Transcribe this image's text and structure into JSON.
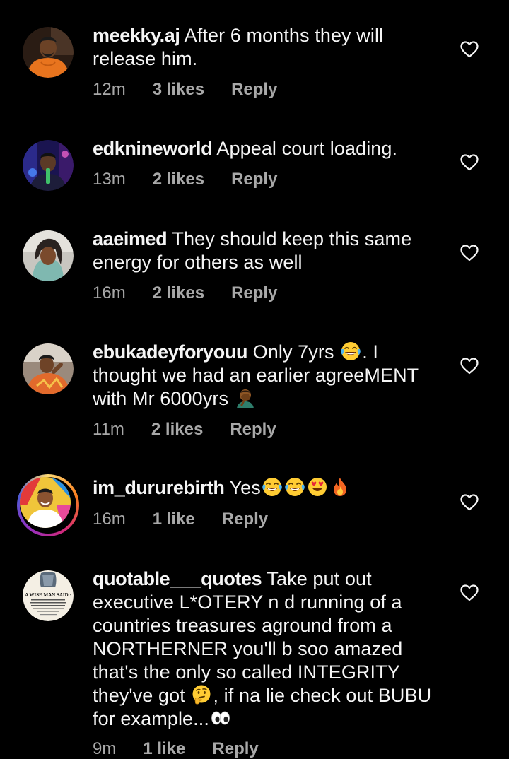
{
  "comments": [
    {
      "username": "meekky.aj",
      "text": "After 6 months they will release him.",
      "time": "12m",
      "likes": "3 likes",
      "reply": "Reply"
    },
    {
      "username": "edknineworld",
      "text": "Appeal court loading.",
      "time": "13m",
      "likes": "2 likes",
      "reply": "Reply"
    },
    {
      "username": "aaeimed",
      "text": "They should keep this same energy for others as well",
      "time": "16m",
      "likes": "2 likes",
      "reply": "Reply"
    },
    {
      "username": "ebukadeyforyouu",
      "text_1": "Only 7yrs",
      "text_2": ". I thought we had an earlier agreeMENT with Mr 6000yrs",
      "time": "11m",
      "likes": "2 likes",
      "reply": "Reply"
    },
    {
      "username": "im_dururebirth",
      "text": "Yes",
      "time": "16m",
      "likes": "1 like",
      "reply": "Reply"
    },
    {
      "username": "quotable___quotes",
      "text_1": "Take put out executive L*OTERY n d  running of a countries treasures aground from a NORTHERNER you'll b soo amazed that's the only so called INTEGRITY they've got",
      "text_2": ", if na lie check out BUBU for example...",
      "avatar_caption": "A WISE MAN SAID :",
      "time": "9m",
      "likes": "1 like",
      "reply": "Reply"
    }
  ],
  "icons": {
    "heart": "heart-outline-icon",
    "laugh": "face-with-tears-of-joy-emoji",
    "facepalm": "person-facepalming-emoji",
    "heart_eyes": "smiling-face-with-heart-eyes-emoji",
    "fire": "fire-emoji",
    "thinking": "thinking-face-emoji",
    "eyes": "eyes-emoji"
  },
  "colors": {
    "background": "#000000",
    "text": "#f5f5f5",
    "meta": "#a8a8a8"
  }
}
